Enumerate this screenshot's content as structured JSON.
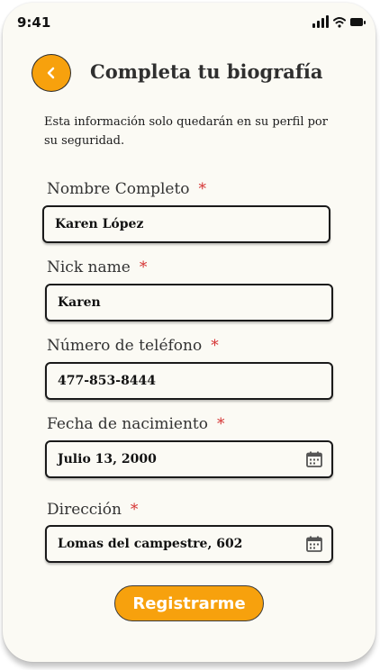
{
  "status_bar": {
    "time": "9:41"
  },
  "header": {
    "title": "Completa tu biografía"
  },
  "subtitle": "Esta información solo quedarán en su perfil por su seguridad.",
  "fields": [
    {
      "label": "Nombre Completo",
      "required_mark": "*",
      "value": "Karen López"
    },
    {
      "label": "Nick name",
      "required_mark": "*",
      "value": "Karen"
    },
    {
      "label": "Número de teléfono",
      "required_mark": "*",
      "value": "477-853-8444"
    },
    {
      "label": "Fecha de nacimiento",
      "required_mark": "*",
      "value": "Julio 13, 2000",
      "icon": "calendar-icon"
    },
    {
      "label": "Dirección",
      "required_mark": "*",
      "value": "Lomas del campestre, 602",
      "icon": "calendar-icon"
    }
  ],
  "register_label": "Registrarme",
  "colors": {
    "accent": "#f7a10d",
    "required": "#d53333",
    "background": "#fbfaf4"
  }
}
